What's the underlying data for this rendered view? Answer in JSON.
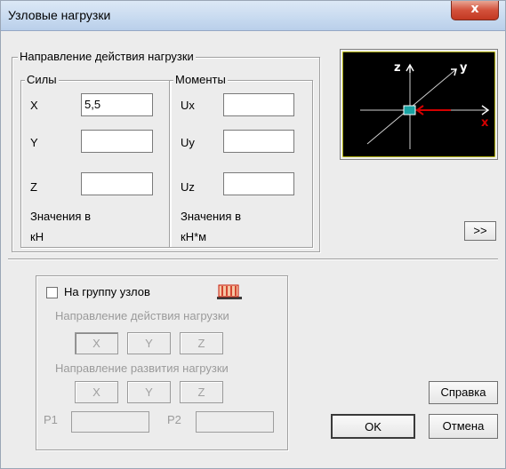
{
  "window": {
    "title": "Узловые нагрузки",
    "close_label": "x"
  },
  "direction_group": {
    "title": "Направление действия нагрузки"
  },
  "forces": {
    "title": "Силы",
    "x_label": "X",
    "x_value": "5,5",
    "y_label": "Y",
    "y_value": "",
    "z_label": "Z",
    "z_value": "",
    "units_caption": "Значения в",
    "units": "кН"
  },
  "moments": {
    "title": "Моменты",
    "ux_label": "Ux",
    "ux_value": "",
    "uy_label": "Uy",
    "uy_value": "",
    "uz_label": "Uz",
    "uz_value": "",
    "units_caption": "Значения в",
    "units": "кН*м"
  },
  "preview": {
    "z_label": "z",
    "y_label": "y",
    "x_label": "x"
  },
  "expand_button": ">>",
  "group_section": {
    "checkbox_label": "На группу узлов",
    "checked": false,
    "load_direction_caption": "Направление действия нагрузки",
    "load_direction_buttons": [
      "X",
      "Y",
      "Z"
    ],
    "spread_direction_caption": "Направление развития нагрузки",
    "spread_direction_buttons": [
      "X",
      "Y",
      "Z"
    ],
    "p1_label": "P1",
    "p1_value": "",
    "p2_label": "P2",
    "p2_value": ""
  },
  "buttons": {
    "help": "Справка",
    "ok": "OK",
    "cancel": "Отмена"
  },
  "colors": {
    "accent_red": "#d40000",
    "preview_bg": "#000000",
    "node_fill": "#19a3a3"
  }
}
